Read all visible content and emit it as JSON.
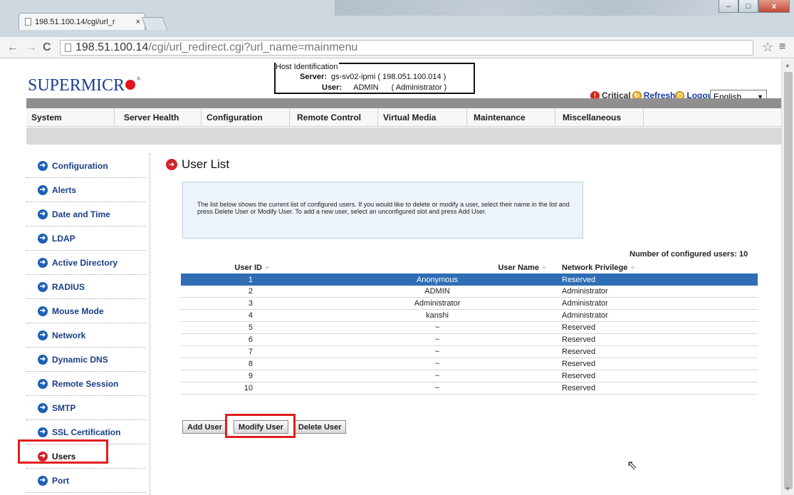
{
  "browser": {
    "tab_title": "198.51.100.14/cgi/url_r",
    "tab_close": "×",
    "back": "←",
    "forward": "→",
    "reload": "C",
    "url_host": "198.51.100.14",
    "url_path": "/cgi/url_redirect.cgi?url_name=mainmenu",
    "star": "☆",
    "menu": "≡",
    "win_minimize": "–",
    "win_maximize": "□",
    "win_close": "x"
  },
  "header": {
    "logo_text": "SUPERMICR",
    "logo_reg": "®",
    "host_legend": "Host Identification",
    "server_label": "Server:",
    "server_value": "gs-sv02-ipmi  ( 198.051.100.014 )",
    "user_label": "User:",
    "user_value": "ADMIN",
    "user_role": "( Administrator )",
    "critical": "Critical",
    "refresh": "Refresh",
    "logout": "Logout",
    "language": "English"
  },
  "menu": [
    "System",
    "Server Health",
    "Configuration",
    "Remote Control",
    "Virtual Media",
    "Maintenance",
    "Miscellaneous"
  ],
  "sidebar": {
    "items": [
      "Configuration",
      "Alerts",
      "Date and Time",
      "LDAP",
      "Active Directory",
      "RADIUS",
      "Mouse Mode",
      "Network",
      "Dynamic DNS",
      "Remote Session",
      "SMTP",
      "SSL Certification",
      "Users",
      "Port"
    ],
    "active": "Users"
  },
  "main": {
    "title": "User List",
    "info": "The list below shows the current list of configured users. If you would like to delete or modify a user, select their name in the list and press Delete User or Modify User. To add a new user, select an unconfigured slot and press Add User.",
    "count_label": "Number of configured users: 10",
    "table": {
      "headers": [
        "User ID",
        "User Name",
        "Network Privilege"
      ],
      "sort_glyph": "÷",
      "rows": [
        [
          "1",
          "Anonymous",
          "Reserved"
        ],
        [
          "2",
          "ADMIN",
          "Administrator"
        ],
        [
          "3",
          "Administrator",
          "Administrator"
        ],
        [
          "4",
          "kanshi",
          "Administrator"
        ],
        [
          "5",
          "~",
          "Reserved"
        ],
        [
          "6",
          "~",
          "Reserved"
        ],
        [
          "7",
          "~",
          "Reserved"
        ],
        [
          "8",
          "~",
          "Reserved"
        ],
        [
          "9",
          "~",
          "Reserved"
        ],
        [
          "10",
          "~",
          "Reserved"
        ]
      ],
      "selected_row": 0
    },
    "buttons": {
      "add": "Add User",
      "modify": "Modify User",
      "delete": "Delete User"
    }
  },
  "colors": {
    "brand_blue": "#1c3d91",
    "selection": "#2f6db4",
    "highlight_red": "#e21e1e"
  }
}
